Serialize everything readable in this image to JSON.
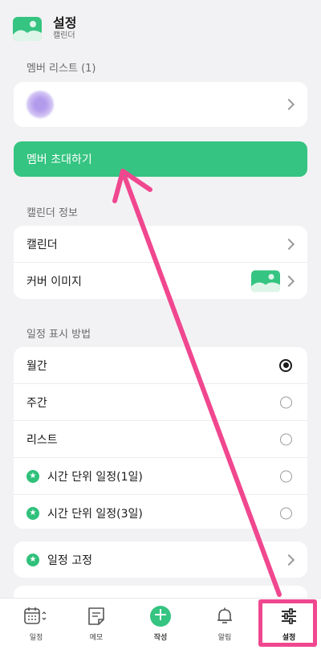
{
  "header": {
    "title": "설정",
    "subtitle": "캘린더"
  },
  "members": {
    "section_label": "멤버 리스트 (1)"
  },
  "invite": {
    "label": "멤버 초대하기"
  },
  "calendar_info": {
    "section_label": "캘린더 정보",
    "calendar_label": "캘린더",
    "cover_label": "커버 이미지"
  },
  "display": {
    "section_label": "일정 표시 방법",
    "options": [
      {
        "label": "월간",
        "selected": true
      },
      {
        "label": "주간",
        "selected": false
      },
      {
        "label": "리스트",
        "selected": false
      },
      {
        "label": "시간 단위 일정(1일)",
        "selected": false,
        "premium": true
      },
      {
        "label": "시간 단위 일정(3일)",
        "selected": false,
        "premium": true
      }
    ]
  },
  "pin": {
    "label": "일정 고정"
  },
  "tabbar": {
    "items": [
      {
        "label": "일정",
        "icon": "calendar-icon"
      },
      {
        "label": "메모",
        "icon": "memo-icon"
      },
      {
        "label": "작성",
        "icon": "add-icon"
      },
      {
        "label": "알림",
        "icon": "bell-icon"
      },
      {
        "label": "설정",
        "icon": "sliders-icon",
        "active": true
      }
    ]
  },
  "colors": {
    "accent": "#35c481",
    "annotation": "#f0478f"
  }
}
